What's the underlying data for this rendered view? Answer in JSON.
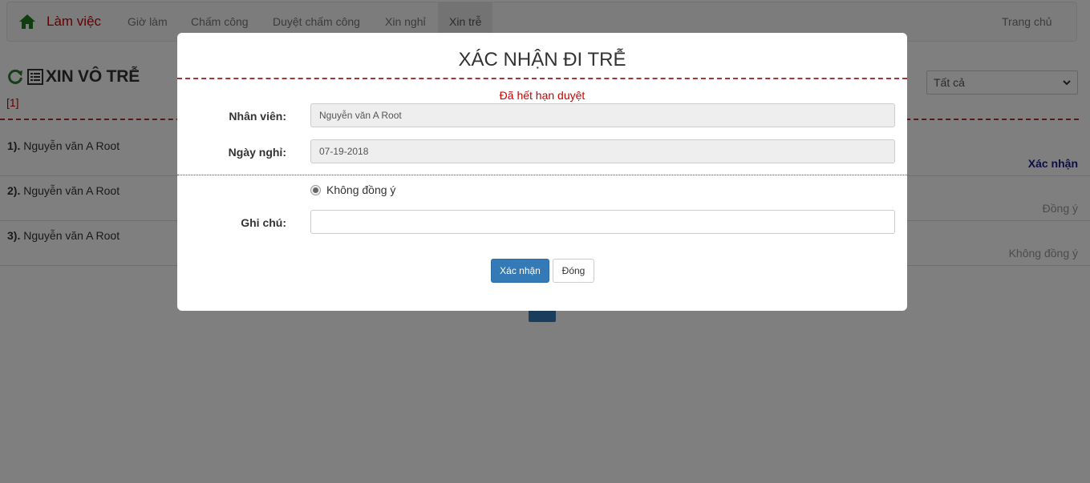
{
  "navbar": {
    "brand": "Làm việc",
    "items": [
      {
        "label": "Giờ làm"
      },
      {
        "label": "Chấm công"
      },
      {
        "label": "Duyệt chấm công"
      },
      {
        "label": "Xin nghỉ"
      },
      {
        "label": "Xin trễ",
        "active": true
      }
    ],
    "home_link": "Trang chủ"
  },
  "page": {
    "title": "XIN VÔ TRỄ",
    "count": "[1]",
    "filter": {
      "selected": "Tất cả"
    }
  },
  "list": [
    {
      "index": "1).",
      "name": "Nguyễn văn A Root",
      "status": "Xác nhận"
    },
    {
      "index": "2).",
      "name": "Nguyễn văn A Root",
      "status": "Đồng ý"
    },
    {
      "index": "3).",
      "name": "Nguyễn văn A Root",
      "status": "Không đồng ý"
    }
  ],
  "modal": {
    "title": "XÁC NHẬN ĐI TRỄ",
    "notice": "Đã hết hạn duyệt",
    "employee_label": "Nhân viên:",
    "employee_value": "Nguyễn văn A Root",
    "date_label": "Ngày nghỉ:",
    "date_value": "07-19-2018",
    "radio_label": "Không đồng ý",
    "note_label": "Ghi chú:",
    "note_value": "",
    "confirm_button": "Xác nhận",
    "close_button": "Đóng"
  },
  "colors": {
    "brand": "#cc0000",
    "icon_green": "#2e7d32",
    "primary": "#337ab7",
    "dashed_divider": "#aa3333"
  }
}
